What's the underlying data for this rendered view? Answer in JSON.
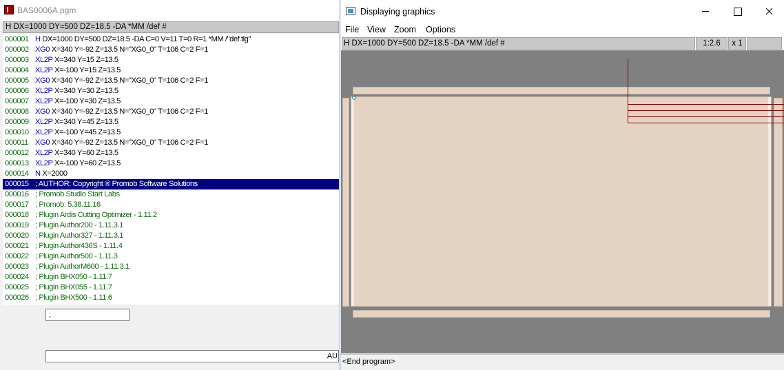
{
  "left_window": {
    "title": "BAS0006A.pgm",
    "header": "H DX=1000 DY=500 DZ=18.5 -DA *MM /def #",
    "rows": [
      {
        "ln": "000001",
        "cmd": "H",
        "text": " DX=1000 DY=500 DZ=18.5 -DA C=0 V=11 T=0 R=1 *MM /\"def.tlg\"",
        "comment": false
      },
      {
        "ln": "000002",
        "cmd": "XG0",
        "text": " X=340 Y=-92 Z=13.5 N=\"XG0_0\" T=106 C=2 F=1",
        "comment": false
      },
      {
        "ln": "000003",
        "cmd": "XL2P",
        "text": " X=340 Y=15 Z=13.5",
        "comment": false
      },
      {
        "ln": "000004",
        "cmd": "XL2P",
        "text": " X=-100 Y=15 Z=13.5",
        "comment": false
      },
      {
        "ln": "000005",
        "cmd": "XG0",
        "text": " X=340 Y=-92 Z=13.5 N=\"XG0_0\" T=106 C=2 F=1",
        "comment": false
      },
      {
        "ln": "000006",
        "cmd": "XL2P",
        "text": " X=340 Y=30 Z=13.5",
        "comment": false
      },
      {
        "ln": "000007",
        "cmd": "XL2P",
        "text": " X=-100 Y=30 Z=13.5",
        "comment": false
      },
      {
        "ln": "000008",
        "cmd": "XG0",
        "text": " X=340 Y=-92 Z=13.5 N=\"XG0_0\" T=106 C=2 F=1",
        "comment": false
      },
      {
        "ln": "000009",
        "cmd": "XL2P",
        "text": " X=340 Y=45 Z=13.5",
        "comment": false
      },
      {
        "ln": "000010",
        "cmd": "XL2P",
        "text": " X=-100 Y=45 Z=13.5",
        "comment": false
      },
      {
        "ln": "000011",
        "cmd": "XG0",
        "text": " X=340 Y=-92 Z=13.5 N=\"XG0_0\" T=106 C=2 F=1",
        "comment": false
      },
      {
        "ln": "000012",
        "cmd": "XL2P",
        "text": " X=340 Y=60 Z=13.5",
        "comment": false
      },
      {
        "ln": "000013",
        "cmd": "XL2P",
        "text": " X=-100 Y=60 Z=13.5",
        "comment": false
      },
      {
        "ln": "000014",
        "cmd": "N",
        "text": " X=2000",
        "comment": false
      },
      {
        "ln": "000015",
        "cmd": "",
        "text": "; AUTHOR: Copyright ® Promob Software Solutions",
        "comment": true,
        "selected": true
      },
      {
        "ln": "000016",
        "cmd": "",
        "text": "; Promob Studio Start Labs",
        "comment": true
      },
      {
        "ln": "000017",
        "cmd": "",
        "text": "; Promob: 5.38.11.16",
        "comment": true
      },
      {
        "ln": "000018",
        "cmd": "",
        "text": "; Plugin Ardis Cutting Optimizer - 1.11.2",
        "comment": true
      },
      {
        "ln": "000019",
        "cmd": "",
        "text": "; Plugin Author200 - 1.11.3.1",
        "comment": true
      },
      {
        "ln": "000020",
        "cmd": "",
        "text": "; Plugin Author327 - 1.11.3.1",
        "comment": true
      },
      {
        "ln": "000021",
        "cmd": "",
        "text": "; Plugin Author436S - 1.11.4",
        "comment": true
      },
      {
        "ln": "000022",
        "cmd": "",
        "text": "; Plugin Author500 - 1.11.3",
        "comment": true
      },
      {
        "ln": "000023",
        "cmd": "",
        "text": "; Plugin AuthorM600 - 1.11.3.1",
        "comment": true
      },
      {
        "ln": "000024",
        "cmd": "",
        "text": "; Plugin BHX050 - 1.11.7",
        "comment": true
      },
      {
        "ln": "000025",
        "cmd": "",
        "text": "; Plugin BHX055 - 1.11.7",
        "comment": true
      },
      {
        "ln": "000026",
        "cmd": "",
        "text": "; Plugin BHX500 - 1.11.6",
        "comment": true
      }
    ],
    "edit_value": ";",
    "status_value": "AU"
  },
  "right_window": {
    "title": "Displaying graphics",
    "menu": [
      "File",
      "View",
      "Zoom",
      "Options"
    ],
    "header": "H DX=1000 DY=500 DZ=18.5 -DA *MM /def #",
    "scale": "1:2.6",
    "multiplier": "x 1",
    "status": "<End program>"
  },
  "icons": {
    "left_app": "pgm-app-icon",
    "right_app": "graphics-window-icon",
    "minimize": "minimize-icon",
    "maximize": "maximize-icon",
    "close": "close-icon"
  },
  "colors": {
    "selection": "#000080",
    "line_number": "#0f6e0f",
    "command": "#0000c8",
    "board": "#e4d2c2",
    "canvas": "#808080",
    "cut_line": "#8b0000"
  }
}
